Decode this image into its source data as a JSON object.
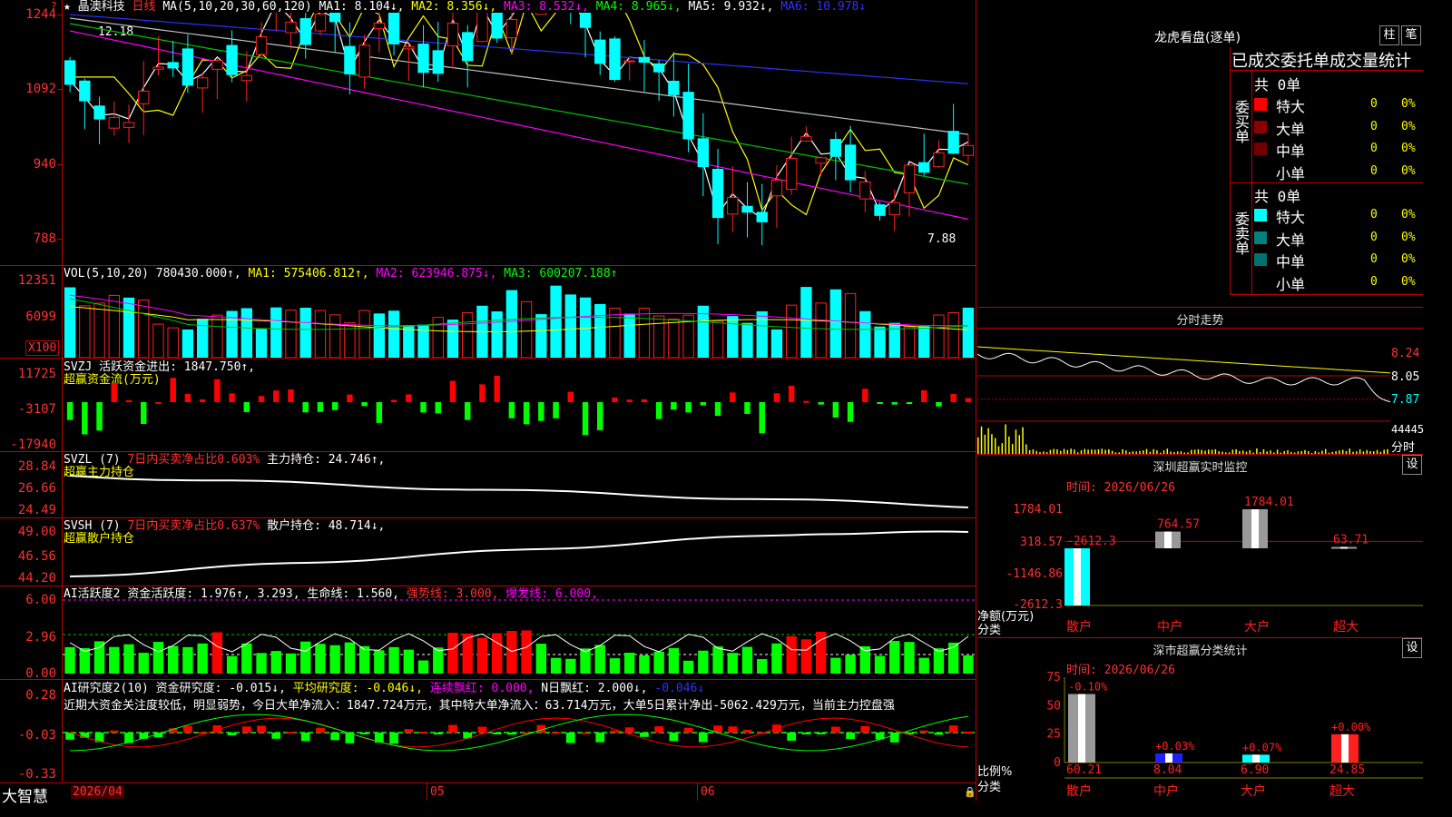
{
  "colors": {
    "grid": "#c00000",
    "up": "#ff2020",
    "down": "#00ffff",
    "bull": "#ff0000",
    "bear": "#00ff00",
    "white": "#ffffff",
    "yellow": "#ffff00",
    "magenta": "#ff00ff",
    "green": "#00c000",
    "blue": "#3030ff",
    "gray": "#c0c0c0"
  },
  "main": {
    "star": "★",
    "stock_name": "晶澳科技",
    "period": "日线",
    "ma_label": "MA(5,10,20,30,60,120)",
    "ma1": "MA1: 8.104↓,",
    "ma2": "MA2: 8.356↓,",
    "ma3": "MA3: 8.532↓,",
    "ma4": "MA4: 8.965↓,",
    "ma5": "MA5: 9.932↓,",
    "ma6": "MA6: 10.978↓",
    "yticks": [
      "1244",
      "1092",
      "940",
      "788"
    ],
    "hi_label": "12.18",
    "lo_label": "7.88"
  },
  "vol": {
    "title": "VOL(5,10,20)",
    "value": "780430.000↑,",
    "ma1": "MA1: 575406.812↑,",
    "ma2": "MA2: 623946.875↓,",
    "ma3": "MA3: 600207.188↑",
    "yticks": [
      "12351",
      "6099"
    ],
    "unit": "X100"
  },
  "svzj": {
    "title": "SVZJ",
    "label": "活跃资金进出: 1847.750↑,",
    "sub": "超赢资金流(万元)",
    "yticks": [
      "11725",
      "-3107",
      "-17940"
    ]
  },
  "svzl": {
    "title": "SVZL (7)",
    "ratio": "7日内买卖净占比0.603%",
    "hold": "主力持仓: 24.746↑,",
    "sub": "超赢主力持仓",
    "yticks": [
      "28.84",
      "26.66",
      "24.49"
    ]
  },
  "svsh": {
    "title": "SVSH (7)",
    "ratio": "7日内买卖净占比0.637%",
    "hold": "散户持仓: 48.714↓,",
    "sub": "超赢散户持仓",
    "yticks": [
      "49.00",
      "46.56",
      "44.20"
    ]
  },
  "ai1": {
    "title": "AI活跃度2",
    "act": "资金活跃度: 1.976↑,",
    "v2": "3.293,",
    "life": "生命线: 1.560,",
    "strong": "强势线: 3.000,",
    "burst": "爆发线: 6.000,",
    "yticks": [
      "6.00",
      "2.96",
      "0.00"
    ]
  },
  "ai2": {
    "title": "AI研究度2(10)",
    "res": "资金研究度: -0.015↓,",
    "avg": "平均研究度: -0.046↓,",
    "red": "连续飘红: 0.000,",
    "nred": "N日飘红: 2.000↓,",
    "last": "-0.046↓",
    "yticks": [
      "0.28",
      "-0.03",
      "-0.33"
    ],
    "note": "近期大资金关注度较低，明显弱势，今日大单净流入：1847.724万元，其中特大单净流入：63.714万元，大单5日累计净出-5062.429万元，当前主力控盘强"
  },
  "footer": {
    "brand": "大智慧",
    "date": "2026/04",
    "m05": "05",
    "m06": "06"
  },
  "lhb": {
    "title": "龙虎看盘(逐单)",
    "btn1": "柱",
    "btn2": "笔",
    "tabs": "已成交委托单成交量统计",
    "buy_side": "委买单",
    "sell_side": "委卖单",
    "buy_total": "共 0单",
    "sell_total": "共 0单",
    "buy_rows": [
      {
        "label": "特大",
        "count": "0",
        "pct": "0%",
        "color": "#ff0000"
      },
      {
        "label": "大单",
        "count": "0",
        "pct": "0%",
        "color": "#8b0000"
      },
      {
        "label": "中单",
        "count": "0",
        "pct": "0%",
        "color": "#700000"
      },
      {
        "label": "小单",
        "count": "0",
        "pct": "0%",
        "color": "#000000"
      }
    ],
    "sell_rows": [
      {
        "label": "特大",
        "count": "0",
        "pct": "0%",
        "color": "#00ffff"
      },
      {
        "label": "大单",
        "count": "0",
        "pct": "0%",
        "color": "#008080"
      },
      {
        "label": "中单",
        "count": "0",
        "pct": "0%",
        "color": "#007070"
      },
      {
        "label": "小单",
        "count": "0",
        "pct": "0%",
        "color": "#000000"
      }
    ]
  },
  "intraday": {
    "title": "分时走势",
    "yticks": [
      "8.24",
      "8.05",
      "7.87"
    ],
    "vol_label": "44445",
    "unit": "分时"
  },
  "monitor": {
    "title": "深圳超赢实时监控",
    "btn": "设",
    "time_label": "时间: 2026/06/26",
    "yticks": [
      "1784.01",
      "318.57",
      "-1146.86",
      "-2612.3"
    ],
    "ylabel1": "净额(万元)",
    "ylabel2": "分类",
    "categories": [
      "散户",
      "中户",
      "大户",
      "超大"
    ],
    "values": [
      -2612.3,
      764.57,
      1784.01,
      63.71
    ],
    "value_labels": [
      "-2612.3",
      "764.57",
      "1784.01",
      "63.71"
    ]
  },
  "stats": {
    "title": "深市超赢分类统计",
    "btn": "设",
    "time_label": "时间: 2026/06/26",
    "yticks": [
      "75",
      "50",
      "25",
      "0"
    ],
    "ylabel1": "比例%",
    "ylabel2": "分类",
    "categories": [
      "散户",
      "中户",
      "大户",
      "超大"
    ],
    "values": [
      60.21,
      8.04,
      6.9,
      24.85
    ],
    "value_labels": [
      "60.21",
      "8.04",
      "6.90",
      "24.85"
    ],
    "changes": [
      "-0.10%",
      "+0.03%",
      "+0.07%",
      "+0.00%"
    ]
  }
}
